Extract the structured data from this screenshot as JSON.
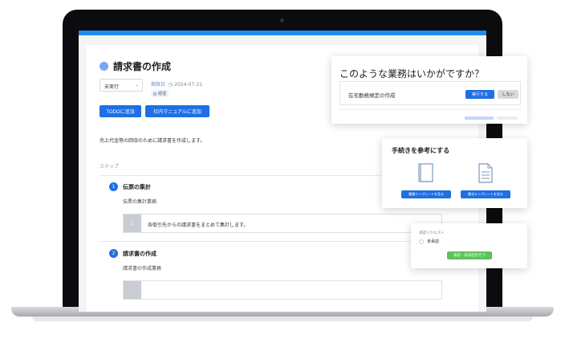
{
  "task": {
    "title": "請求書の作成",
    "status": "未実行",
    "deadline_label": "期限日",
    "deadline_date": "2024-07-31",
    "tag": "経理",
    "add_todo_label": "TODOに追加",
    "add_manual_label": "社内マニュアルに追加",
    "description": "売上代金等の回収のために請求書を作成します。",
    "steps_heading": "ステップ",
    "steps": [
      {
        "number": "1",
        "title": "伝票の集計",
        "subtitle": "伝票の集計業務",
        "substeps": [
          {
            "number": "1",
            "text": "各取引先からの請求書をまとめて集計します。"
          }
        ]
      },
      {
        "number": "2",
        "title": "請求書の作成",
        "subtitle": "請求書の作成業務"
      }
    ]
  },
  "suggest_panel": {
    "title": "このような業務はいかがですか？",
    "items": [
      {
        "text": "在宅勤務規定の作成",
        "run_label": "実行する",
        "skip_label": "しない"
      }
    ]
  },
  "reference_panel": {
    "title": "手続きを参考にする",
    "buttons": [
      "書類テンプレートを見る",
      "書式テンプレートを見る"
    ]
  },
  "approval_panel": {
    "heading": "承認リクエスト",
    "status": "未承認",
    "action_label": "承認・非承認を行う"
  },
  "colors": {
    "accent": "#1f6fe5",
    "topbar": "#1e8cf0",
    "approve": "#5cc35a"
  }
}
